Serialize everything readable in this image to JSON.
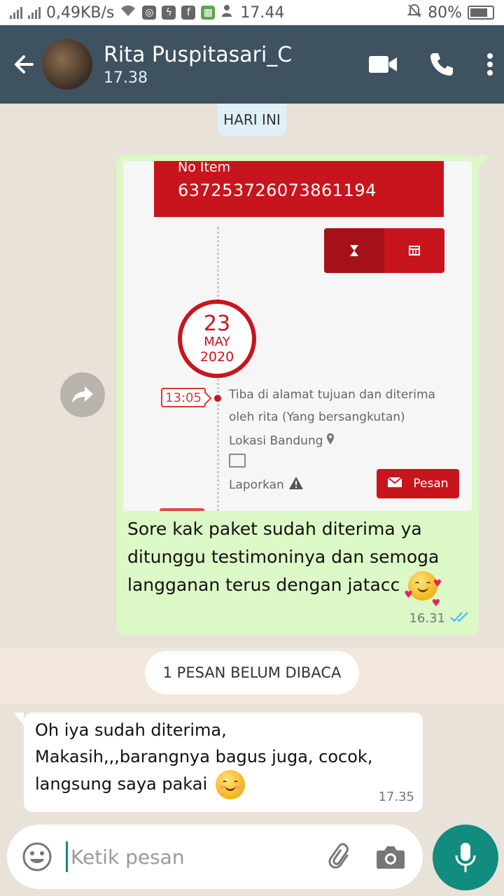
{
  "status_bar": {
    "net_speed": "0,49KB/s",
    "time": "17.44",
    "battery": "80%",
    "battery_level": 0.8,
    "icons": [
      "signal-icon",
      "signal-icon",
      "wifi-icon",
      "instagram-icon",
      "messenger-icon",
      "facebook-icon",
      "gallery-icon",
      "person-icon",
      "mute-icon",
      "battery-icon"
    ]
  },
  "header": {
    "contact_name": "Rita Puspitasari_C",
    "contact_status": "17.38",
    "icons": [
      "back-arrow-icon",
      "video-call-icon",
      "phone-call-icon",
      "more-vertical-icon"
    ]
  },
  "chat": {
    "day_chip": "HARI INI",
    "outgoing": {
      "screenshot": {
        "label_no_item": "No Item",
        "item_number": "637253726073861194",
        "date_day": "23",
        "date_month": "MAY",
        "date_year": "2020",
        "time_tag": "13:05",
        "event_line1": "Tiba di alamat tujuan dan diterima",
        "event_line2": "oleh rita (Yang bersangkutan)",
        "location": "Lokasi Bandung",
        "report": "Laporkan",
        "pesan_button": "Pesan"
      },
      "text_line1": "Sore kak paket sudah diterima ya",
      "text_line2": "ditunggu testimoninya dan semoga",
      "text_line3": "langganan terus dengan jatacc",
      "time": "16.31",
      "status": "read"
    },
    "unread_banner": "1 PESAN BELUM DIBACA",
    "incoming": {
      "text_line1": "Oh iya sudah diterima,",
      "text_line2": "Makasih,,,barangnya bagus juga, cocok,",
      "text_line3": "langsung saya pakai",
      "time": "17.35"
    }
  },
  "composer": {
    "placeholder": "Ketik pesan"
  },
  "colors": {
    "header": "#3e5260",
    "outgoing_bubble": "#dcf8c6",
    "incoming_bubble": "#ffffff",
    "accent": "#128c7e",
    "tracking_red": "#c8151d",
    "read_ticks": "#4fc3f7"
  }
}
